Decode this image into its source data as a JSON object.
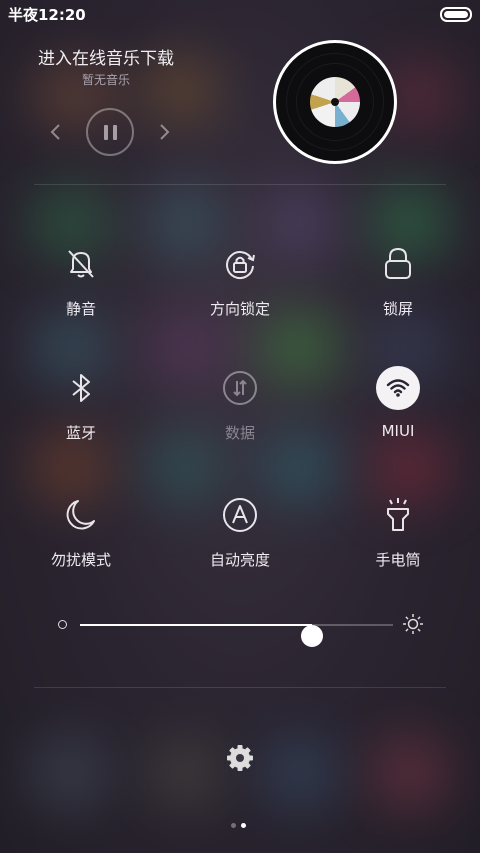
{
  "status_bar": {
    "time": "半夜12:20"
  },
  "music": {
    "title": "进入在线音乐下载",
    "subtitle": "暂无音乐",
    "prev_icon": "chevron-left-icon",
    "play_pause_icon": "pause-icon",
    "next_icon": "chevron-right-icon"
  },
  "toggles": [
    {
      "label": "静音",
      "icon": "bell-off-icon",
      "active": false,
      "enabled": true
    },
    {
      "label": "方向锁定",
      "icon": "rotation-lock-icon",
      "active": false,
      "enabled": true
    },
    {
      "label": "锁屏",
      "icon": "lock-icon",
      "active": false,
      "enabled": true
    },
    {
      "label": "蓝牙",
      "icon": "bluetooth-icon",
      "active": false,
      "enabled": true
    },
    {
      "label": "数据",
      "icon": "mobile-data-icon",
      "active": false,
      "enabled": false
    },
    {
      "label": "MIUI",
      "icon": "wifi-icon",
      "active": true,
      "enabled": true
    },
    {
      "label": "勿扰模式",
      "icon": "moon-icon",
      "active": false,
      "enabled": true
    },
    {
      "label": "自动亮度",
      "icon": "auto-brightness-icon",
      "active": false,
      "enabled": true
    },
    {
      "label": "手电筒",
      "icon": "flashlight-icon",
      "active": false,
      "enabled": true
    }
  ],
  "brightness": {
    "level": 0.74,
    "min_icon": "brightness-low-icon",
    "max_icon": "brightness-high-icon"
  },
  "settings_icon": "gear-icon",
  "pager": {
    "pages": 2,
    "current": 2
  },
  "colors": {
    "accent_active_bg": "#f4f2f4",
    "text": "#eeeaf0",
    "dim_text": "#8a8590"
  }
}
